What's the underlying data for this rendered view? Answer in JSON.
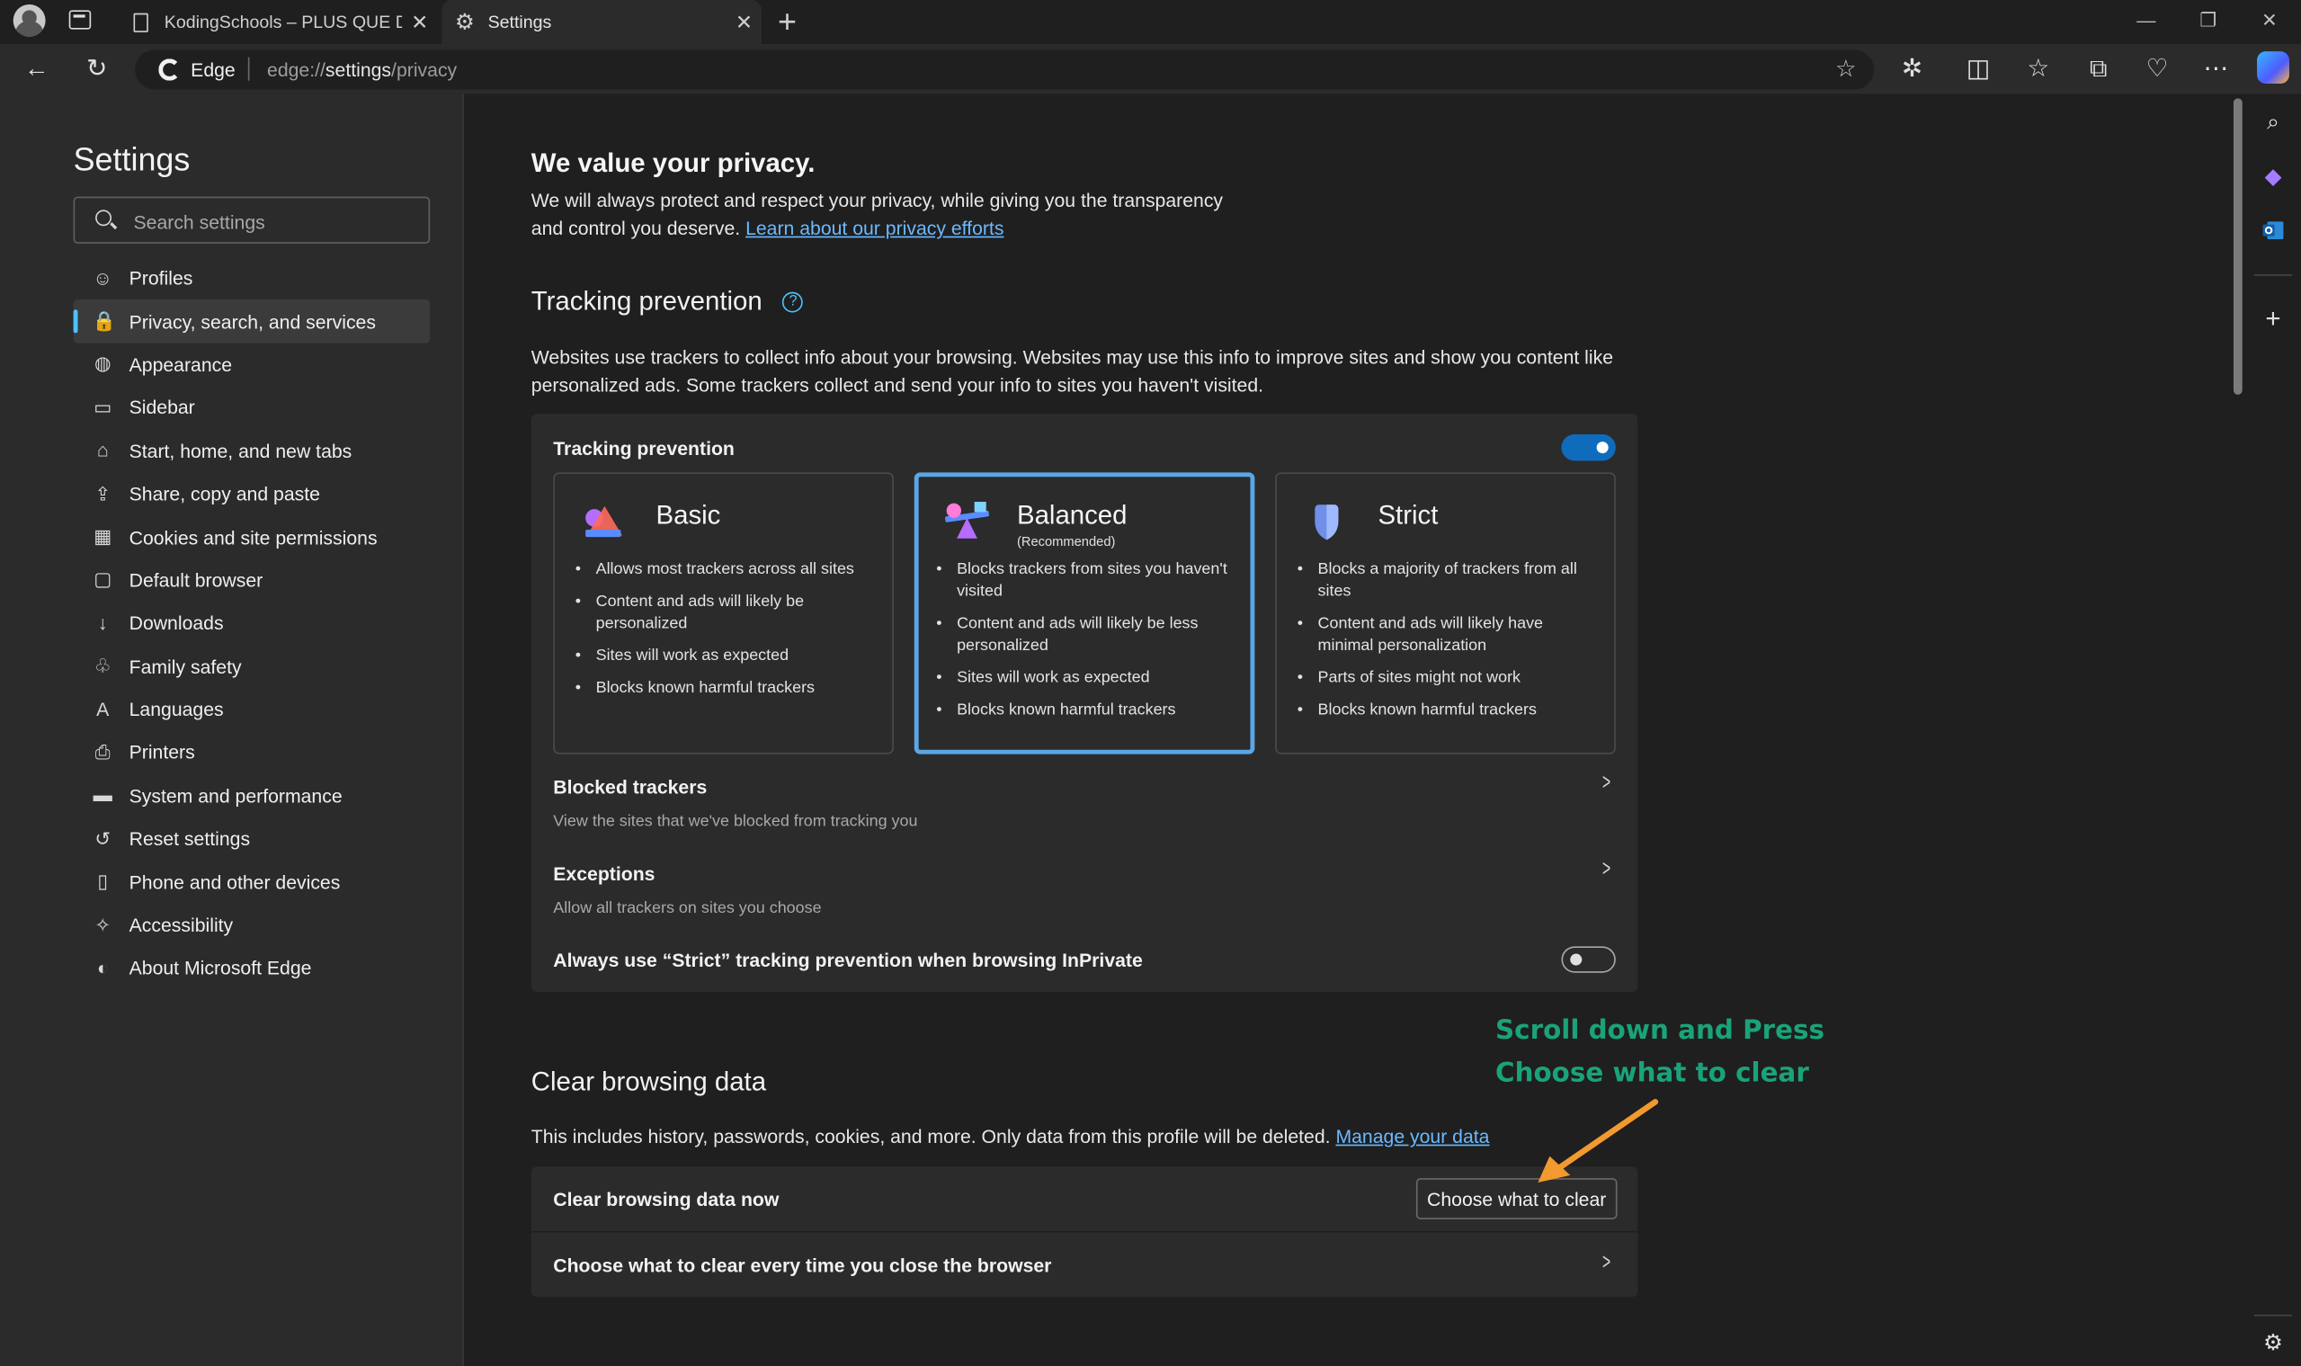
{
  "browser": {
    "tabs": [
      {
        "title": "KodingSchools – PLUS QUE DU C"
      },
      {
        "title": "Settings"
      }
    ],
    "address": {
      "site_label": "Edge",
      "url_prefix": "edge://",
      "url_path_main": "settings",
      "url_path_rest": "/privacy"
    }
  },
  "settings_nav": {
    "title": "Settings",
    "search_placeholder": "Search settings",
    "items": [
      {
        "label": "Profiles",
        "icon": "profile-icon"
      },
      {
        "label": "Privacy, search, and services",
        "icon": "lock-icon",
        "active": true
      },
      {
        "label": "Appearance",
        "icon": "palette-icon"
      },
      {
        "label": "Sidebar",
        "icon": "sidebar-icon"
      },
      {
        "label": "Start, home, and new tabs",
        "icon": "home-icon"
      },
      {
        "label": "Share, copy and paste",
        "icon": "share-icon"
      },
      {
        "label": "Cookies and site permissions",
        "icon": "cookie-icon"
      },
      {
        "label": "Default browser",
        "icon": "browser-icon"
      },
      {
        "label": "Downloads",
        "icon": "download-icon"
      },
      {
        "label": "Family safety",
        "icon": "family-icon"
      },
      {
        "label": "Languages",
        "icon": "language-icon"
      },
      {
        "label": "Printers",
        "icon": "printer-icon"
      },
      {
        "label": "System and performance",
        "icon": "laptop-icon"
      },
      {
        "label": "Reset settings",
        "icon": "reset-icon"
      },
      {
        "label": "Phone and other devices",
        "icon": "phone-icon"
      },
      {
        "label": "Accessibility",
        "icon": "accessibility-icon"
      },
      {
        "label": "About Microsoft Edge",
        "icon": "edge-icon"
      }
    ]
  },
  "privacy": {
    "title": "We value your privacy.",
    "description": "We will always protect and respect your privacy, while giving you the transparency and control you deserve.",
    "link": "Learn about our privacy efforts"
  },
  "tracking": {
    "section_title": "Tracking prevention",
    "description": "Websites use trackers to collect info about your browsing. Websites may use this info to improve sites and show you content like personalized ads. Some trackers collect and send your info to sites you haven't visited.",
    "card_title": "Tracking prevention",
    "enabled": true,
    "options": [
      {
        "name": "Basic",
        "subtitle": "",
        "selected": false,
        "bullets": [
          "Allows most trackers across all sites",
          "Content and ads will likely be personalized",
          "Sites will work as expected",
          "Blocks known harmful trackers"
        ]
      },
      {
        "name": "Balanced",
        "subtitle": "(Recommended)",
        "selected": true,
        "bullets": [
          "Blocks trackers from sites you haven't visited",
          "Content and ads will likely be less personalized",
          "Sites will work as expected",
          "Blocks known harmful trackers"
        ]
      },
      {
        "name": "Strict",
        "subtitle": "",
        "selected": false,
        "bullets": [
          "Blocks a majority of trackers from all sites",
          "Content and ads will likely have minimal personalization",
          "Parts of sites might not work",
          "Blocks known harmful trackers"
        ]
      }
    ],
    "blocked_title": "Blocked trackers",
    "blocked_sub": "View the sites that we've blocked from tracking you",
    "exceptions_title": "Exceptions",
    "exceptions_sub": "Allow all trackers on sites you choose",
    "inprivate_label": "Always use “Strict” tracking prevention when browsing InPrivate",
    "inprivate_enabled": false
  },
  "clear_data": {
    "section_title": "Clear browsing data",
    "description": "This includes history, passwords, cookies, and more. Only data from this profile will be deleted.",
    "link": "Manage your data",
    "now_label": "Clear browsing data now",
    "button": "Choose what to clear",
    "on_close_label": "Choose what to clear every time you close the browser"
  },
  "annotation": {
    "line1": "Scroll down and Press",
    "line2": "Choose what to clear",
    "color": "#1aa37a",
    "arrow_color": "#f29a2e"
  },
  "colors": {
    "accent": "#4cc2ff",
    "toggle_on": "#0f6cbd",
    "link": "#6cb9ff",
    "selected_border": "#5aa7e6"
  }
}
